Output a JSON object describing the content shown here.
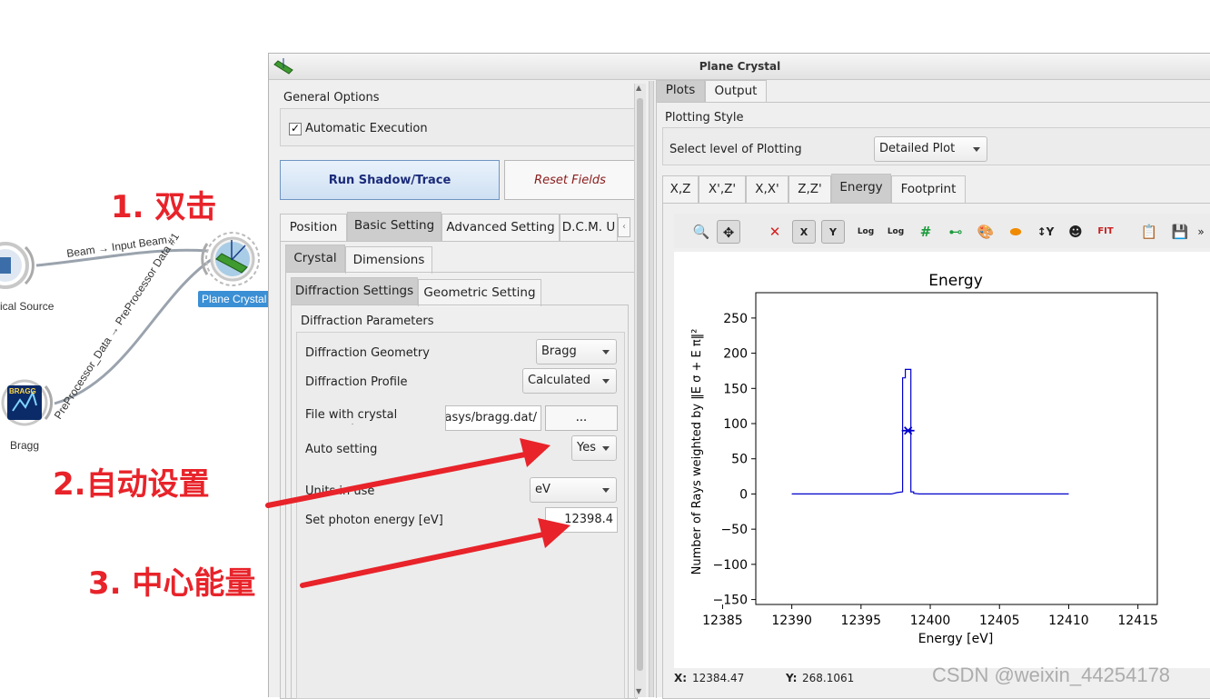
{
  "canvas": {
    "nodes": [
      {
        "label": "ical Source"
      },
      {
        "label": "Plane Crystal"
      },
      {
        "label": "Bragg"
      }
    ],
    "links": [
      {
        "label": "Beam → Input Beam"
      },
      {
        "label": "PreProcessor_Data → PreProcessor Data #1"
      }
    ],
    "bragg_icon_text": "BRAGG"
  },
  "annotations": {
    "step1": "1. 双击",
    "step2": "2.自动设置",
    "step3": "3. 中心能量",
    "arrow_color": "#e8232a"
  },
  "window": {
    "title": "Plane Crystal",
    "left": {
      "general_options": "General Options",
      "automatic_execution": "Automatic Execution",
      "automatic_execution_checked": true,
      "run_button": "Run Shadow/Trace",
      "reset_button": "Reset Fields",
      "tabs": [
        "Position",
        "Basic Setting",
        "Advanced Setting",
        "D.C.M. U"
      ],
      "subtabs": [
        "Crystal",
        "Dimensions"
      ],
      "subsubtabs": [
        "Diffraction Settings",
        "Geometric Setting"
      ],
      "section_title": "Diffraction Parameters",
      "rows": {
        "geometry_label": "Diffraction Geometry",
        "geometry_value": "Bragg",
        "profile_label": "Diffraction Profile",
        "profile_value": "Calculated",
        "file_label": "File with crystal parameters",
        "file_value": "/Oasys/bragg.dat",
        "browse_button": "...",
        "auto_label": "Auto setting",
        "auto_value": "Yes",
        "units_label": "Units in use",
        "units_value": "eV",
        "energy_label": "Set photon energy [eV]",
        "energy_value": "12398.4"
      }
    },
    "right": {
      "top_tabs": [
        "Plots",
        "Output"
      ],
      "plotting_style": "Plotting Style",
      "level_label": "Select level of Plotting",
      "level_value": "Detailed Plot",
      "plot_tabs": [
        "X,Z",
        "X',Z'",
        "X,X'",
        "Z,Z'",
        "Energy",
        "Footprint"
      ],
      "toolbar_icons": [
        "zoom-icon",
        "pan-icon",
        "reset-zoom-icon",
        "x-autoscale-icon",
        "y-autoscale-icon",
        "x-log-icon",
        "y-log-icon",
        "grid-icon",
        "curve-style-icon",
        "colormap-icon",
        "shape-icon",
        "y-axis-direction-icon",
        "mask-icon",
        "fit-icon",
        "copy-icon",
        "save-icon",
        "more-icon"
      ],
      "x_readout_label": "X:",
      "x_readout_value": "12384.47",
      "y_readout_label": "Y:",
      "y_readout_value": "268.1061"
    }
  },
  "watermark": "CSDN @weixin_44254178",
  "chart_data": {
    "type": "line",
    "title": "Energy",
    "xlabel": "Energy [eV]",
    "ylabel": "Number of Rays weighted by ‖E σ + E π‖²",
    "xlim": [
      12387.4,
      12416.4
    ],
    "ylim": [
      -157,
      286
    ],
    "xticks": [
      12385,
      12390,
      12395,
      12400,
      12405,
      12410,
      12415
    ],
    "yticks": [
      -150,
      -100,
      -50,
      0,
      50,
      100,
      150,
      200,
      250
    ],
    "grid": false,
    "color": "#0000cc",
    "series": [
      {
        "x": [
          12390.0,
          12397.2,
          12397.6,
          12398.0,
          12398.0,
          12398.2,
          12398.2,
          12398.6,
          12398.6,
          12398.8,
          12398.8,
          12399.2,
          12410.0
        ],
        "values": [
          0,
          0,
          2,
          3,
          165,
          165,
          177,
          177,
          3,
          3,
          1,
          0,
          0
        ]
      }
    ],
    "marker": {
      "x": 12398.4,
      "y": 90
    }
  }
}
